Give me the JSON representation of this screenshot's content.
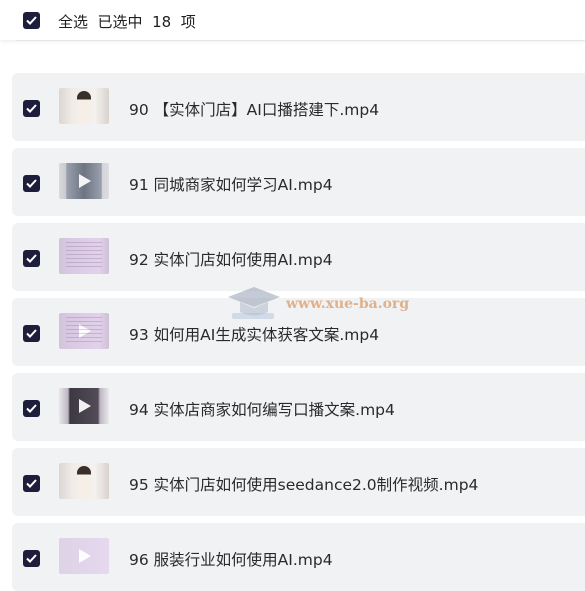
{
  "header": {
    "select_all_checked": true,
    "select_text": "全选  已选中  18  项"
  },
  "items": [
    {
      "title": "",
      "checked": true,
      "thumb": "woman-icon"
    },
    {
      "title": "90 【实体门店】AI口播搭建下.mp4",
      "checked": true,
      "thumb": "woman-icon"
    },
    {
      "title": "91 同城商家如何学习AI.mp4",
      "checked": true,
      "thumb": "tablet-video-icon"
    },
    {
      "title": "92 实体门店如何使用AI.mp4",
      "checked": true,
      "thumb": "document-icon"
    },
    {
      "title": "93 如何用AI生成实体获客文案.mp4",
      "checked": true,
      "thumb": "document-play-icon"
    },
    {
      "title": "94 实体店商家如何编写口播文案.mp4",
      "checked": true,
      "thumb": "dark-play-icon"
    },
    {
      "title": "95 实体门店如何使用seedance2.0制作视频.mp4",
      "checked": true,
      "thumb": "woman-icon"
    },
    {
      "title": "96 服装行业如何使用AI.mp4",
      "checked": true,
      "thumb": "document-play-icon"
    }
  ],
  "watermark": {
    "text": "www.xue-ba.org"
  },
  "colors": {
    "checkbox": "#1e1e3c",
    "row_bg": "#f1f2f4",
    "watermark": "#dca06e"
  }
}
